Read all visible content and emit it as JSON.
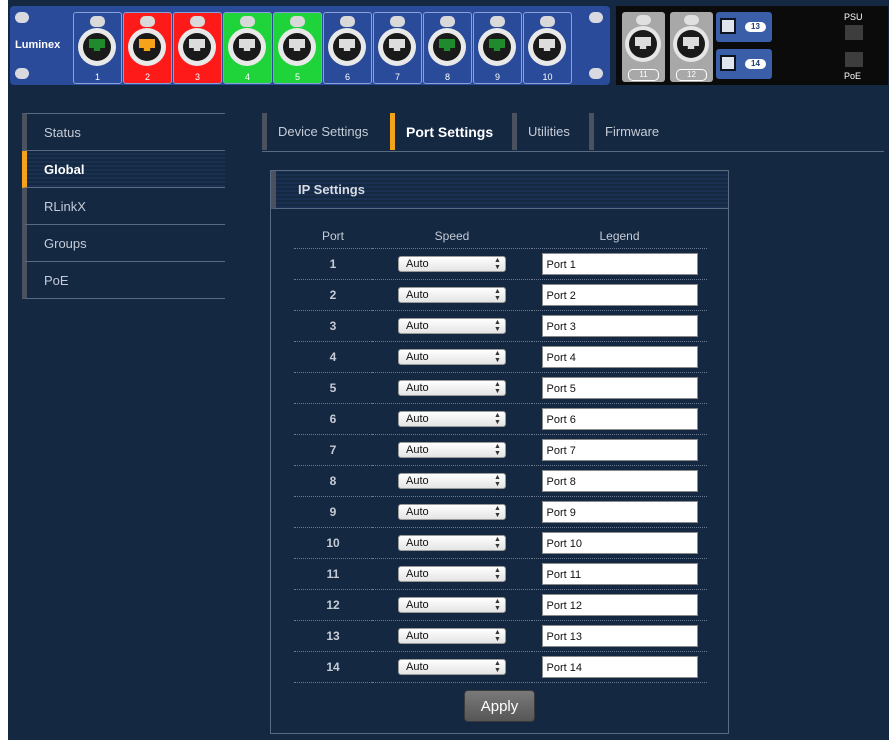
{
  "device": {
    "brand": "Luminex",
    "ports": [
      {
        "number": "1",
        "color": "#2a4a9a",
        "jack_color": "#1f8a2e"
      },
      {
        "number": "2",
        "color": "#ff1a1a",
        "jack_color": "#f5a31a"
      },
      {
        "number": "3",
        "color": "#ff1a1a",
        "jack_color": "#dcdcdc"
      },
      {
        "number": "4",
        "color": "#1fd43a",
        "jack_color": "#dcdcdc"
      },
      {
        "number": "5",
        "color": "#1fd43a",
        "jack_color": "#dcdcdc"
      },
      {
        "number": "6",
        "color": "#2a4a9a",
        "jack_color": "#dcdcdc"
      },
      {
        "number": "7",
        "color": "#2a4a9a",
        "jack_color": "#dcdcdc"
      },
      {
        "number": "8",
        "color": "#2a4a9a",
        "jack_color": "#1f8a2e"
      },
      {
        "number": "9",
        "color": "#2a4a9a",
        "jack_color": "#1f8a2e"
      },
      {
        "number": "10",
        "color": "#2a4a9a",
        "jack_color": "#dcdcdc"
      }
    ],
    "gigabit_ports": [
      {
        "number": "11"
      },
      {
        "number": "12"
      }
    ],
    "sfp_ports": [
      {
        "number": "13"
      },
      {
        "number": "14"
      }
    ],
    "psu_label": "PSU",
    "poe_label": "PoE"
  },
  "nav": {
    "items": [
      {
        "label": "Status",
        "active": false
      },
      {
        "label": "Global",
        "active": true
      },
      {
        "label": "RLinkX",
        "active": false
      },
      {
        "label": "Groups",
        "active": false
      },
      {
        "label": "PoE",
        "active": false
      }
    ]
  },
  "tabs": [
    {
      "label": "Device Settings",
      "active": false
    },
    {
      "label": "Port Settings",
      "active": true
    },
    {
      "label": "Utilities",
      "active": false
    },
    {
      "label": "Firmware",
      "active": false
    }
  ],
  "panel": {
    "title": "IP Settings",
    "columns": {
      "port": "Port",
      "speed": "Speed",
      "legend": "Legend"
    },
    "rows": [
      {
        "port": "1",
        "speed": "Auto",
        "legend": "Port 1"
      },
      {
        "port": "2",
        "speed": "Auto",
        "legend": "Port 2"
      },
      {
        "port": "3",
        "speed": "Auto",
        "legend": "Port 3"
      },
      {
        "port": "4",
        "speed": "Auto",
        "legend": "Port 4"
      },
      {
        "port": "5",
        "speed": "Auto",
        "legend": "Port 5"
      },
      {
        "port": "6",
        "speed": "Auto",
        "legend": "Port 6"
      },
      {
        "port": "7",
        "speed": "Auto",
        "legend": "Port 7"
      },
      {
        "port": "8",
        "speed": "Auto",
        "legend": "Port 8"
      },
      {
        "port": "9",
        "speed": "Auto",
        "legend": "Port 9"
      },
      {
        "port": "10",
        "speed": "Auto",
        "legend": "Port 10"
      },
      {
        "port": "11",
        "speed": "Auto",
        "legend": "Port 11"
      },
      {
        "port": "12",
        "speed": "Auto",
        "legend": "Port 12"
      },
      {
        "port": "13",
        "speed": "Auto",
        "legend": "Port 13"
      },
      {
        "port": "14",
        "speed": "Auto",
        "legend": "Port 14"
      }
    ],
    "apply_label": "Apply"
  },
  "colors": {
    "accent": "#f5a31a",
    "background": "#142842",
    "device_blue": "#2a4a9a"
  }
}
